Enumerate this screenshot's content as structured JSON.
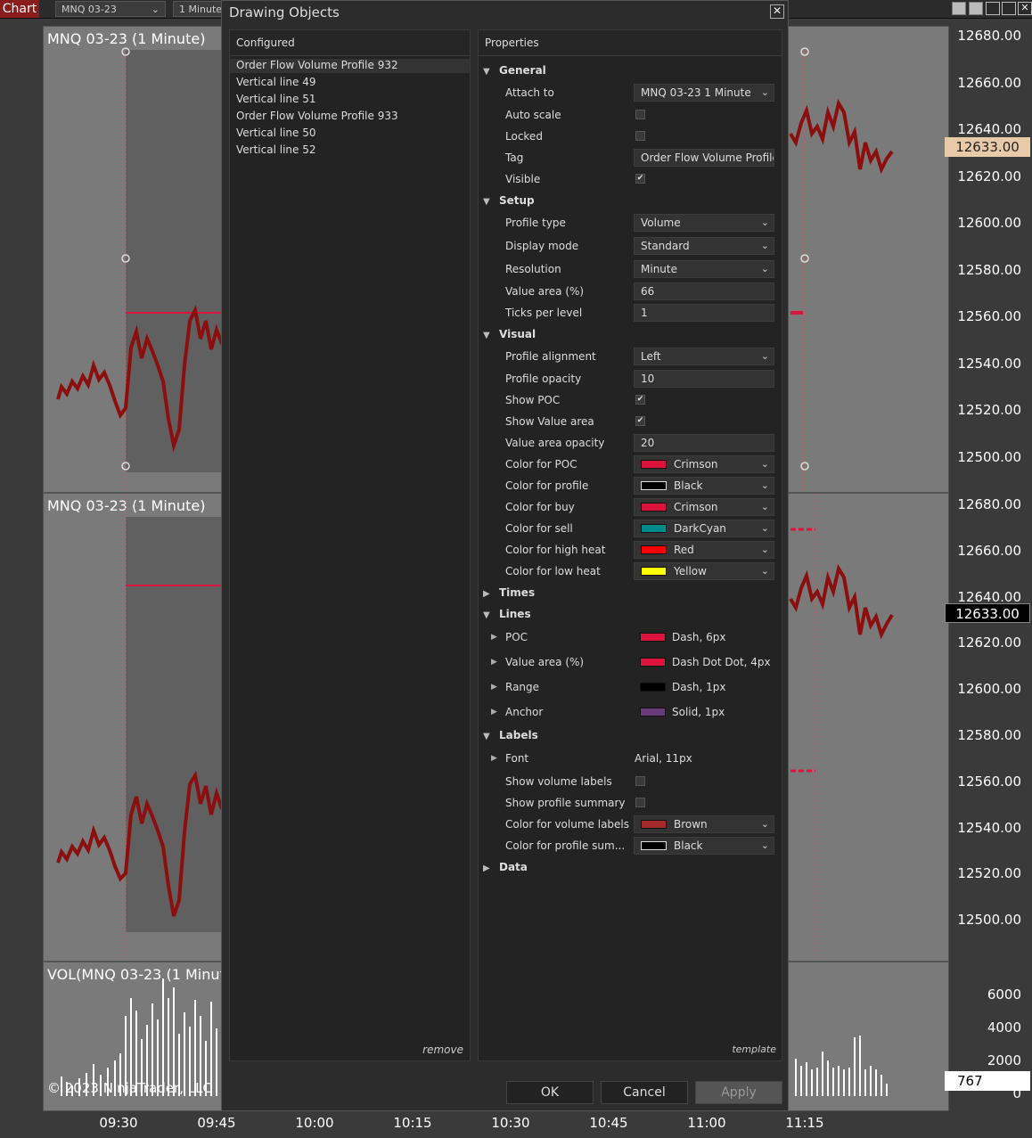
{
  "toolbar": {
    "chart_tab": "Chart",
    "instrument": "MNQ 03-23",
    "interval": "1 Minute"
  },
  "chart": {
    "panel1_title": "MNQ 03-23 (1 Minute)",
    "panel2_title": "MNQ 03-23 (1 Minute)",
    "panel3_title": "VOL(MNQ 03-23 (1 Minut",
    "copyright": "© 2023 NinjaTrader, LLC",
    "price_labels": [
      "12680.00",
      "12660.00",
      "12640.00",
      "12620.00",
      "12600.00",
      "12580.00",
      "12560.00",
      "12540.00",
      "12520.00",
      "12500.00"
    ],
    "vol_labels": [
      "6000",
      "4000",
      "2000",
      "0"
    ],
    "price_marker_1": "12633.00",
    "price_marker_2": "12633.00",
    "vol_marker": "767",
    "time_labels": [
      "09:30",
      "09:45",
      "10:00",
      "10:15",
      "10:30",
      "10:45",
      "11:00",
      "11:15"
    ],
    "colors": {
      "bar": "#8b0f0f",
      "panel": "#7a7a7a",
      "marker1": "#e8c9a8"
    }
  },
  "dialog": {
    "title": "Drawing Objects",
    "close_icon": "close-icon",
    "configured_header": "Configured",
    "configured_items": [
      "Order Flow Volume Profile 932",
      "Vertical line 49",
      "Vertical line 51",
      "Order Flow Volume Profile 933",
      "Vertical line 50",
      "Vertical line 52"
    ],
    "remove_label": "remove",
    "properties_header": "Properties",
    "template_label": "template",
    "sections": {
      "general": "General",
      "setup": "Setup",
      "visual": "Visual",
      "times": "Times",
      "lines": "Lines",
      "labels": "Labels",
      "data": "Data"
    },
    "props": {
      "attach_to": {
        "label": "Attach to",
        "value": "MNQ 03-23 1 Minute"
      },
      "auto_scale": {
        "label": "Auto scale",
        "checked": false
      },
      "locked": {
        "label": "Locked",
        "checked": false
      },
      "tag": {
        "label": "Tag",
        "value": "Order Flow Volume Profile"
      },
      "visible": {
        "label": "Visible",
        "checked": true
      },
      "profile_type": {
        "label": "Profile type",
        "value": "Volume"
      },
      "display_mode": {
        "label": "Display mode",
        "value": "Standard"
      },
      "resolution": {
        "label": "Resolution",
        "value": "Minute"
      },
      "value_area": {
        "label": "Value area (%)",
        "value": "66"
      },
      "ticks_per_level": {
        "label": "Ticks per level",
        "value": "1"
      },
      "profile_alignment": {
        "label": "Profile alignment",
        "value": "Left"
      },
      "profile_opacity": {
        "label": "Profile opacity",
        "value": "10"
      },
      "show_poc": {
        "label": "Show POC",
        "checked": true
      },
      "show_value_area": {
        "label": "Show Value area",
        "checked": true
      },
      "value_area_opacity": {
        "label": "Value area opacity",
        "value": "20"
      },
      "color_poc": {
        "label": "Color for POC",
        "value": "Crimson",
        "color": "#dc143c"
      },
      "color_profile": {
        "label": "Color for profile",
        "value": "Black",
        "color": "#000000"
      },
      "color_buy": {
        "label": "Color for buy",
        "value": "Crimson",
        "color": "#dc143c"
      },
      "color_sell": {
        "label": "Color for sell",
        "value": "DarkCyan",
        "color": "#008b8b"
      },
      "color_high_heat": {
        "label": "Color for high heat",
        "value": "Red",
        "color": "#ff0000"
      },
      "color_low_heat": {
        "label": "Color for low heat",
        "value": "Yellow",
        "color": "#ffff00"
      },
      "line_poc": {
        "label": "POC",
        "value": "Dash, 6px",
        "color": "#dc143c"
      },
      "line_value_area": {
        "label": "Value area (%)",
        "value": "Dash Dot Dot, 4px",
        "color": "#dc143c"
      },
      "line_range": {
        "label": "Range",
        "value": "Dash, 1px",
        "color": "#000000"
      },
      "line_anchor": {
        "label": "Anchor",
        "value": "Solid, 1px",
        "color": "#6a3a7a"
      },
      "font": {
        "label": "Font",
        "value": "Arial, 11px"
      },
      "show_volume_labels": {
        "label": "Show volume labels",
        "checked": false
      },
      "show_profile_summary": {
        "label": "Show profile summary",
        "checked": false
      },
      "color_volume_labels": {
        "label": "Color for volume labels",
        "value": "Brown",
        "color": "#a52a2a"
      },
      "color_profile_summary": {
        "label": "Color for profile sum...",
        "value": "Black",
        "color": "#000000"
      }
    },
    "buttons": {
      "ok": "OK",
      "cancel": "Cancel",
      "apply": "Apply"
    }
  }
}
